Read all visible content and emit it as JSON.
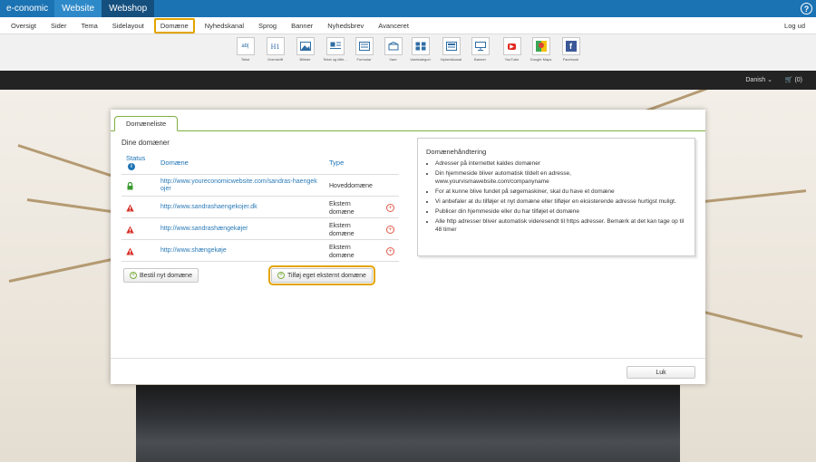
{
  "topbar": {
    "brand": "e-conomic",
    "tabs": [
      "Website",
      "Webshop"
    ],
    "help": "?"
  },
  "nav": {
    "items": [
      "Oversigt",
      "Sider",
      "Tema",
      "Sidelayout",
      "Domæne",
      "Nyhedskanal",
      "Sprog",
      "Banner",
      "Nyhedsbrev",
      "Avanceret"
    ],
    "active": "Domæne",
    "logout": "Log ud"
  },
  "toolbar": {
    "tools": [
      {
        "label": "Tekst",
        "icon": "text-icon"
      },
      {
        "label": "Overskrift",
        "icon": "heading-icon"
      },
      {
        "label": "Billede",
        "icon": "image-icon"
      },
      {
        "label": "Tekst og bille...",
        "icon": "text-image-icon"
      },
      {
        "label": "Formular",
        "icon": "form-icon"
      },
      {
        "label": "Vare",
        "icon": "product-icon"
      },
      {
        "label": "Varekategori",
        "icon": "category-icon"
      },
      {
        "label": "Nyhedskanal",
        "icon": "news-icon"
      },
      {
        "label": "Banner",
        "icon": "banner-icon"
      },
      {
        "label": "YouTube",
        "icon": "youtube-icon"
      },
      {
        "label": "Google Maps",
        "icon": "maps-icon"
      },
      {
        "label": "Facebook",
        "icon": "facebook-icon"
      }
    ],
    "glyphs": {
      "text": "ab|",
      "heading": "H1",
      "youtube": "▶",
      "facebook": "f"
    }
  },
  "site": {
    "language": "Danish",
    "cart": "(0)"
  },
  "modal": {
    "tab": "Domæneliste",
    "section_title": "Dine domæner",
    "columns": {
      "status": "Status",
      "domain": "Domæne",
      "type": "Type"
    },
    "rows": [
      {
        "status": "ok",
        "domain": "http://www.youreconomicwebsite.com/sandras-haengek ojer",
        "type": "Hoveddomæne",
        "removable": false
      },
      {
        "status": "warning",
        "domain": "http://www.sandrashaengekojer.dk",
        "type": "Ekstern domæne",
        "removable": true
      },
      {
        "status": "warning",
        "domain": "http://www.sandrashængekøjer",
        "type": "Ekstern domæne",
        "removable": true
      },
      {
        "status": "warning",
        "domain": "http://www.shængekøje",
        "type": "Ekstern domæne",
        "removable": true
      }
    ],
    "order_button": "Bestil nyt domæne",
    "add_external_button": "Tilføj eget eksternt domæne",
    "info": {
      "title": "Domænehåndtering",
      "bullets": [
        "Adresser på internettet kaldes domæner",
        "Din hjemmeside bliver automatisk tildelt en adresse, www.yourvismawebsite.com/companyname",
        "For at kunne blive fundet på søgemaskiner, skal du have et domæne",
        "Vi anbefaler at du tilføjer et nyt domæne eller tilføjer en eksisterende adresse hurtigst muligt.",
        "Publicer din hjemmeside eller du har tilføjet et domæne",
        "Alle http adresser bliver automatisk videresendt til https adresser. Bemærk at det kan tage op til 48 timer"
      ]
    },
    "close_button": "Luk"
  },
  "colors": {
    "topbar": "#1c73b4",
    "highlight": "#e3a400",
    "tab_border": "#7eb040",
    "link": "#2a7ab8",
    "warning": "#d9322b",
    "ok": "#3a9a2f"
  }
}
